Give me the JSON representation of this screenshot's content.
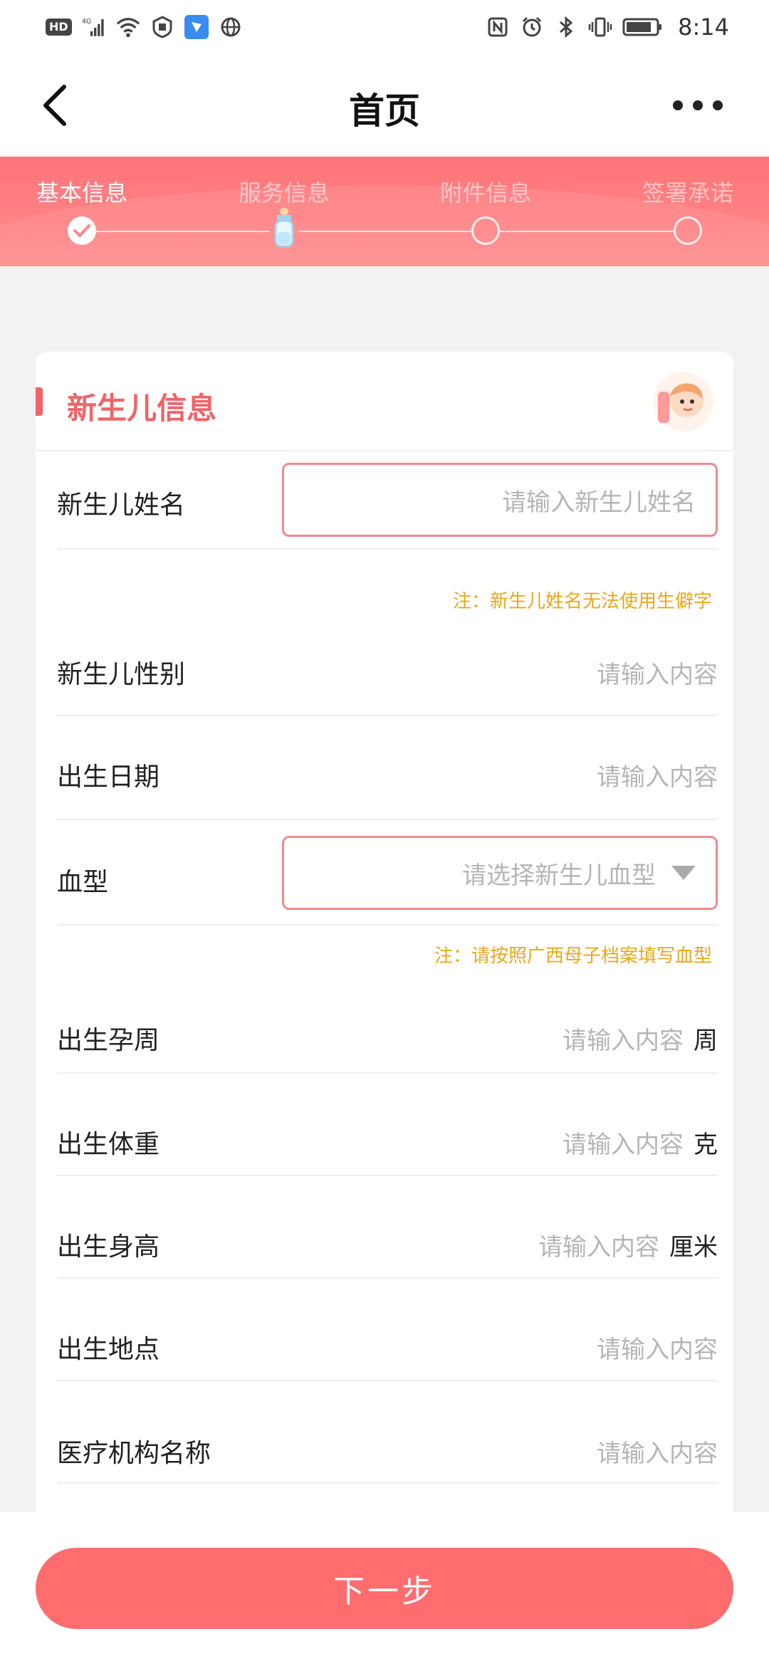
{
  "status_bar": {
    "network": "4G",
    "time": "8:14",
    "hd_label": "HD"
  },
  "nav": {
    "title": "首页"
  },
  "stepper": {
    "steps": [
      {
        "label": "基本信息",
        "state": "done"
      },
      {
        "label": "服务信息",
        "state": "current"
      },
      {
        "label": "附件信息",
        "state": "pending"
      },
      {
        "label": "签署承诺",
        "state": "pending"
      }
    ]
  },
  "card": {
    "title": "新生儿信息",
    "fields": {
      "name": {
        "label": "新生儿姓名",
        "placeholder": "请输入新生儿姓名",
        "note": "注：新生儿姓名无法使用生僻字"
      },
      "gender": {
        "label": "新生儿性别",
        "placeholder": "请输入内容"
      },
      "birth_date": {
        "label": "出生日期",
        "placeholder": "请输入内容"
      },
      "blood_type": {
        "label": "血型",
        "placeholder": "请选择新生儿血型",
        "note": "注：请按照广西母子档案填写血型"
      },
      "gestational_week": {
        "label": "出生孕周",
        "placeholder": "请输入内容",
        "unit": "周"
      },
      "birth_weight": {
        "label": "出生体重",
        "placeholder": "请输入内容",
        "unit": "克"
      },
      "birth_height": {
        "label": "出生身高",
        "placeholder": "请输入内容",
        "unit": "厘米"
      },
      "birth_place": {
        "label": "出生地点",
        "placeholder": "请输入内容"
      },
      "institution": {
        "label": "医疗机构名称",
        "placeholder": "请输入内容"
      }
    }
  },
  "footer": {
    "next_label": "下一步"
  },
  "colors": {
    "accent": "#ff6d6f",
    "title_red": "#ef6468",
    "note_orange": "#e8a81c",
    "placeholder": "#b5b5b5"
  }
}
